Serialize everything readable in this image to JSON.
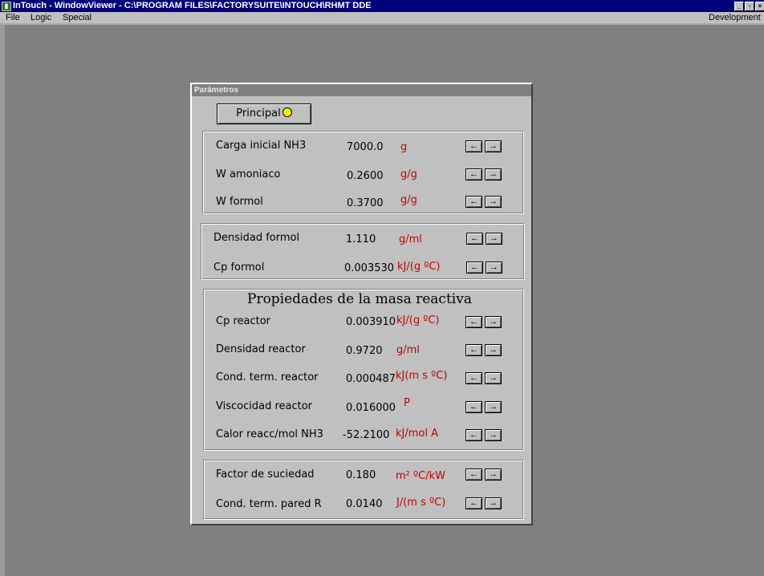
{
  "window": {
    "title": "InTouch - WindowViewer - C:\\PROGRAM FILES\\FACTORYSUITE\\INTOUCH\\RHMT DDE",
    "app_icon": "intouch-icon",
    "controls": [
      "_",
      "ё",
      "×"
    ]
  },
  "menu": {
    "items": [
      "File",
      "Logic",
      "Special"
    ],
    "right": "Development"
  },
  "panel": {
    "title": "Parámetros",
    "principal_label": "Principal",
    "groups": [
      {
        "rows": [
          {
            "label": "Carga inicial NH3",
            "value": "7000.0",
            "unit": "g"
          },
          {
            "label": "W amoniaco",
            "value": "0.2600",
            "unit": "g/g"
          },
          {
            "label": "W formol",
            "value": "0.3700",
            "unit": "g/g"
          }
        ]
      },
      {
        "rows": [
          {
            "label": "Densidad formol",
            "value": "1.110",
            "unit": "g/ml"
          },
          {
            "label": "Cp formol",
            "value": "0.003530",
            "unit": "kJ/(g ºC)"
          }
        ]
      },
      {
        "title": "Propiedades  de la masa reactiva",
        "rows": [
          {
            "label": "Cp reactor",
            "value": "0.003910",
            "unit": "kJ/(g ºC)"
          },
          {
            "label": "Densidad reactor",
            "value": "0.9720",
            "unit": "g/ml"
          },
          {
            "label": "Cond. term. reactor",
            "value": "0.000487",
            "unit": "kJ(m s ºC)"
          },
          {
            "label": "Viscocidad reactor",
            "value": "0.016000",
            "unit": "P"
          },
          {
            "label": "Calor reacc/mol NH3",
            "value": "-52.2100",
            "unit": "kJ/mol A"
          }
        ]
      },
      {
        "rows": [
          {
            "label": "Factor de suciedad",
            "value": "0.180",
            "unit": "m² ºC/kW"
          },
          {
            "label": "Cond. term.  pared R",
            "value": "0.0140",
            "unit": "J/(m s ºC)"
          }
        ]
      }
    ],
    "arrow_left": "←",
    "arrow_right": "→"
  }
}
